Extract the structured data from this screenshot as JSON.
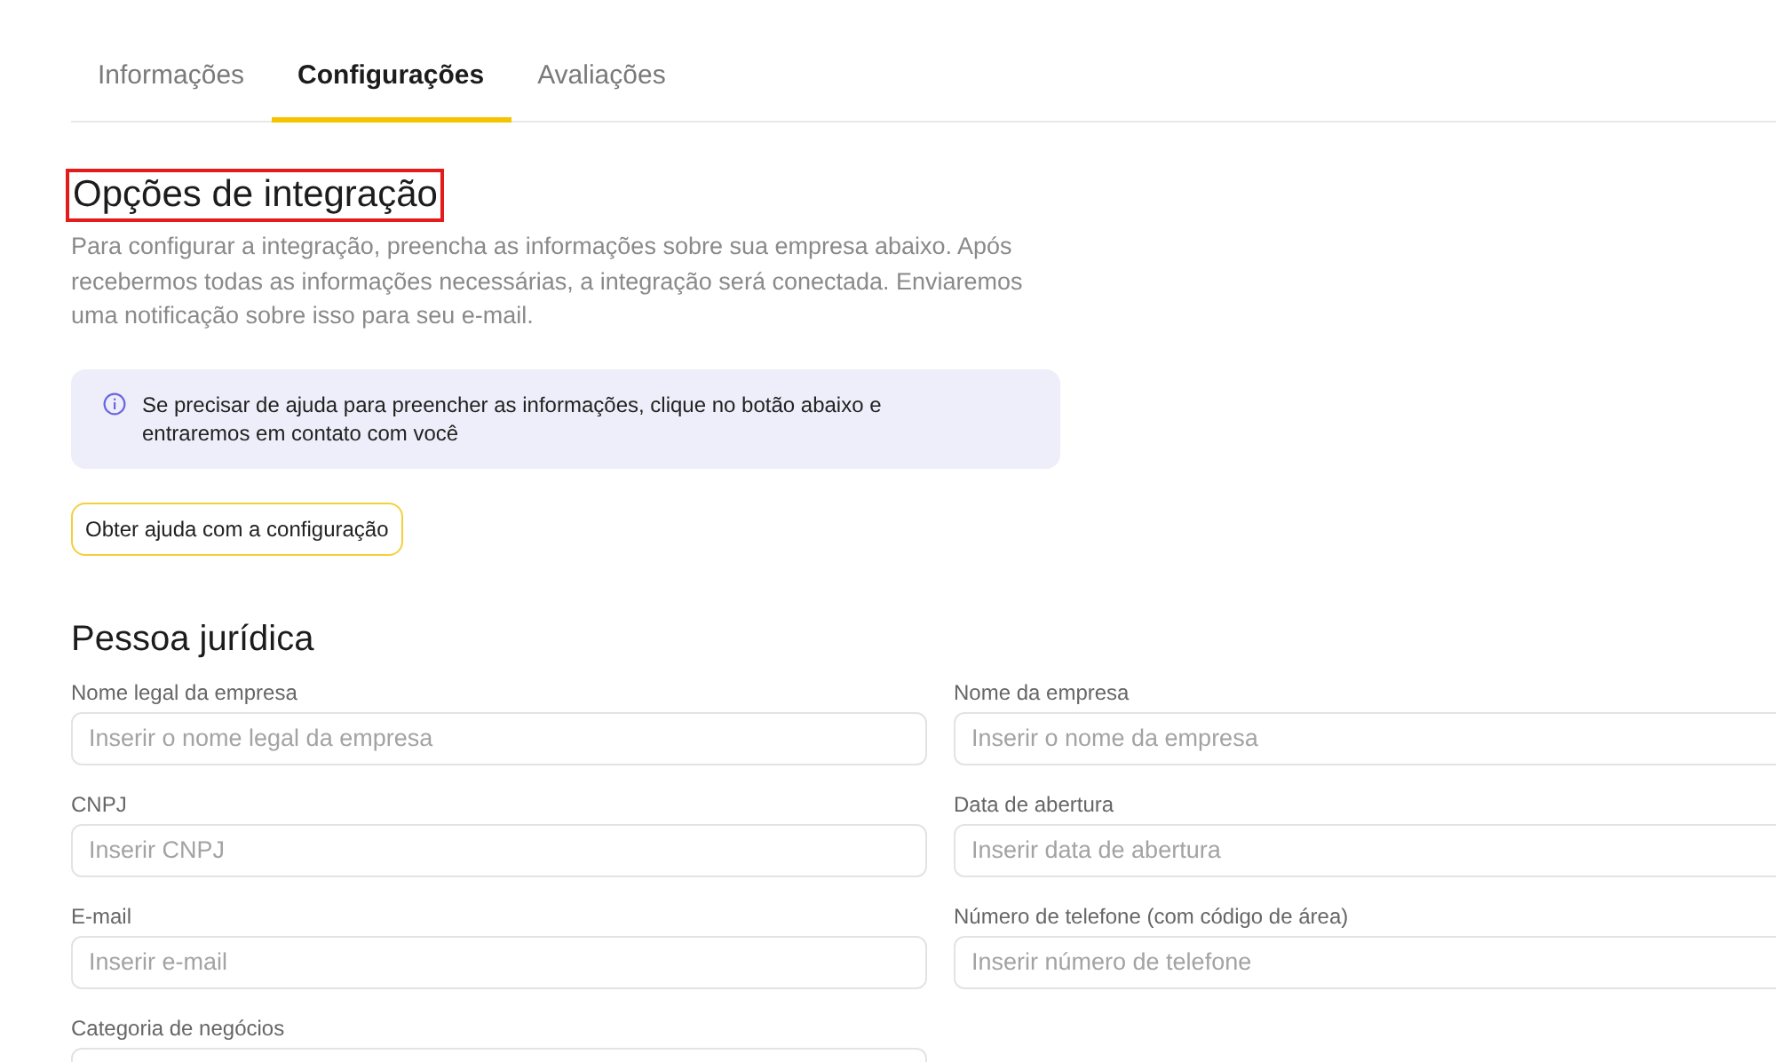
{
  "tabs": [
    {
      "label": "Informações",
      "selected": false
    },
    {
      "label": "Configurações",
      "selected": true
    },
    {
      "label": "Avaliações",
      "selected": false
    }
  ],
  "heading": {
    "text": "Opções de integração",
    "highlighted": true
  },
  "description": "Para configurar a integração, preencha as informações sobre sua empresa abaixo. Após recebermos todas as informações necessárias, a integração será conectada. Enviaremos uma notificação sobre isso para seu e-mail.",
  "info_notice": "Se precisar de ajuda para preencher as informações, clique no botão abaixo e entraremos em contato com você",
  "help_button": "Obter ajuda com a configuração",
  "section_title": "Pessoa jurídica",
  "fields": [
    {
      "label": "Nome legal da empresa",
      "placeholder": "Inserir o nome legal da empresa"
    },
    {
      "label": "Nome da empresa",
      "placeholder": "Inserir o nome da empresa"
    },
    {
      "label": "CNPJ",
      "placeholder": "Inserir CNPJ"
    },
    {
      "label": "Data de abertura",
      "placeholder": "Inserir data de abertura"
    },
    {
      "label": "E-mail",
      "placeholder": "Inserir e-mail"
    },
    {
      "label": "Número de telefone (com código de área)",
      "placeholder": "Inserir número de telefone"
    },
    {
      "label": "Categoria de negócios"
    }
  ]
}
